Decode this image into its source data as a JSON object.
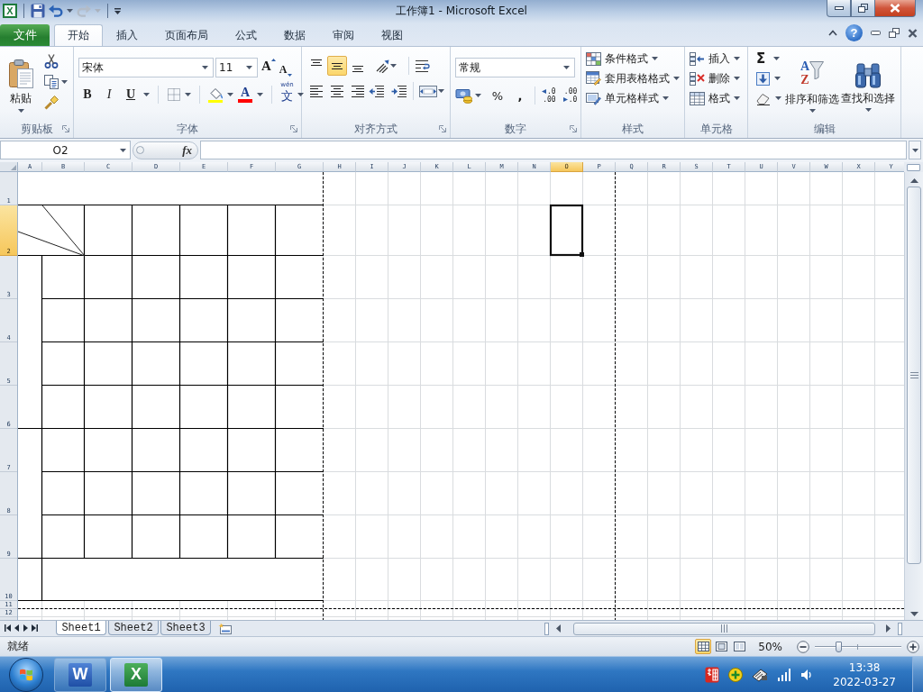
{
  "title_bar": {
    "app_letter": "X",
    "title": "工作簿1 - Microsoft Excel"
  },
  "quick_access": [
    {
      "kind": "save",
      "disabled": false
    },
    {
      "kind": "undo",
      "disabled": false
    },
    {
      "kind": "redo",
      "disabled": true
    }
  ],
  "file_tab": {
    "label": "文件"
  },
  "tabs": [
    {
      "label": "开始",
      "selected": true
    },
    {
      "label": "插入",
      "selected": false
    },
    {
      "label": "页面布局",
      "selected": false
    },
    {
      "label": "公式",
      "selected": false
    },
    {
      "label": "数据",
      "selected": false
    },
    {
      "label": "审阅",
      "selected": false
    },
    {
      "label": "视图",
      "selected": false
    }
  ],
  "help": {
    "label": "?"
  },
  "ribbon": {
    "clipboard": {
      "label": "剪贴板",
      "launcher": true,
      "paste": "粘贴"
    },
    "font": {
      "label": "字体",
      "launcher": true,
      "font_name": "宋体",
      "font_size": "11",
      "grow": "A",
      "shrink": "A",
      "bold": "B",
      "italic": "I",
      "underline": "U",
      "font_color": "A",
      "phonetic_pinyin": "wén",
      "phonetic_char": "文"
    },
    "alignment": {
      "label": "对齐方式",
      "launcher": true,
      "vertical": [
        {
          "kind": "top",
          "selected": false
        },
        {
          "kind": "middle",
          "selected": true
        },
        {
          "kind": "bottom",
          "selected": false
        }
      ],
      "horizontal": [
        {
          "kind": "left",
          "selected": false
        },
        {
          "kind": "center",
          "selected": false
        },
        {
          "kind": "right",
          "selected": false
        }
      ]
    },
    "number": {
      "label": "数字",
      "launcher": true,
      "format": "常规",
      "percent": "%",
      "comma": ",",
      "increase_decimal": [
        ".0",
        ".00"
      ],
      "decrease_decimal": [
        ".00",
        ".0"
      ]
    },
    "styles": {
      "label": "样式",
      "items": [
        {
          "kind": "conditional",
          "label": "条件格式"
        },
        {
          "kind": "table",
          "label": "套用表格格式"
        },
        {
          "kind": "cell_style",
          "label": "单元格样式"
        }
      ]
    },
    "cells": {
      "label": "单元格",
      "items": [
        {
          "kind": "insert",
          "label": "插入"
        },
        {
          "kind": "delete",
          "label": "删除"
        },
        {
          "kind": "format",
          "label": "格式"
        }
      ]
    },
    "editing": {
      "label": "编辑",
      "sum": "Σ",
      "sort_letters": [
        "A",
        "Z"
      ],
      "buttons": [
        {
          "kind": "sort",
          "label": "排序和筛选"
        },
        {
          "kind": "find",
          "label": "查找和选择"
        }
      ]
    }
  },
  "formula_bar": {
    "name_box": "O2",
    "function_label": "fx"
  },
  "sheet": {
    "columns": [
      {
        "label": "A",
        "selected": false
      },
      {
        "label": "B",
        "selected": false
      },
      {
        "label": "C",
        "selected": false
      },
      {
        "label": "D",
        "selected": false
      },
      {
        "label": "E",
        "selected": false
      },
      {
        "label": "F",
        "selected": false
      },
      {
        "label": "G",
        "selected": false
      },
      {
        "label": "H",
        "selected": false
      },
      {
        "label": "I",
        "selected": false
      },
      {
        "label": "J",
        "selected": false
      },
      {
        "label": "K",
        "selected": false
      },
      {
        "label": "L",
        "selected": false
      },
      {
        "label": "M",
        "selected": false
      },
      {
        "label": "N",
        "selected": false
      },
      {
        "label": "O",
        "selected": true
      },
      {
        "label": "P",
        "selected": false
      },
      {
        "label": "Q",
        "selected": false
      },
      {
        "label": "R",
        "selected": false
      },
      {
        "label": "S",
        "selected": false
      },
      {
        "label": "T",
        "selected": false
      },
      {
        "label": "U",
        "selected": false
      },
      {
        "label": "V",
        "selected": false
      },
      {
        "label": "W",
        "selected": false
      },
      {
        "label": "X",
        "selected": false
      },
      {
        "label": "Y",
        "selected": false
      }
    ],
    "rows": [
      {
        "label": "1",
        "selected": false
      },
      {
        "label": "2",
        "selected": true
      },
      {
        "label": "3",
        "selected": false
      },
      {
        "label": "4",
        "selected": false
      },
      {
        "label": "5",
        "selected": false
      },
      {
        "label": "6",
        "selected": false
      },
      {
        "label": "7",
        "selected": false
      },
      {
        "label": "8",
        "selected": false
      },
      {
        "label": "9",
        "selected": false
      },
      {
        "label": "10",
        "selected": false
      },
      {
        "label": "11",
        "selected": false
      },
      {
        "label": "12",
        "selected": false
      }
    ]
  },
  "sheet_tabs": [
    {
      "label": "Sheet1",
      "selected": true
    },
    {
      "label": "Sheet2",
      "selected": false
    },
    {
      "label": "Sheet3",
      "selected": false
    }
  ],
  "status_bar": {
    "status": "就绪",
    "views": [
      {
        "kind": "normal",
        "selected": true
      },
      {
        "kind": "page_layout",
        "selected": false
      },
      {
        "kind": "page_break",
        "selected": false
      }
    ],
    "zoom": "50%",
    "zoom_slider": {
      "level": 0.27
    }
  },
  "taskbar": {
    "apps": [
      {
        "kind": "word",
        "letter": "W",
        "selected": false
      },
      {
        "kind": "excel",
        "letter": "X",
        "selected": true
      }
    ],
    "time": "13:38",
    "date": "2022-03-27"
  }
}
